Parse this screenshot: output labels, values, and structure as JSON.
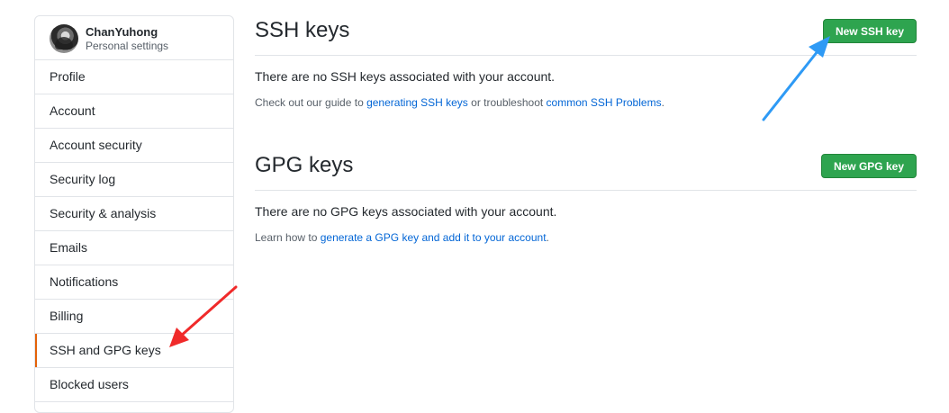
{
  "sidebar": {
    "user": {
      "name": "ChanYuhong",
      "subtitle": "Personal settings"
    },
    "items": [
      {
        "label": "Profile"
      },
      {
        "label": "Account"
      },
      {
        "label": "Account security"
      },
      {
        "label": "Security log"
      },
      {
        "label": "Security & analysis"
      },
      {
        "label": "Emails"
      },
      {
        "label": "Notifications"
      },
      {
        "label": "Billing"
      },
      {
        "label": "SSH and GPG keys",
        "selected": true
      },
      {
        "label": "Blocked users"
      }
    ]
  },
  "ssh": {
    "title": "SSH keys",
    "button": "New SSH key",
    "empty_message": "There are no SSH keys associated with your account.",
    "guide_prefix": "Check out our guide to ",
    "guide_link": "generating SSH keys",
    "guide_middle": " or troubleshoot ",
    "troubleshoot_link": "common SSH Problems",
    "guide_suffix": "."
  },
  "gpg": {
    "title": "GPG keys",
    "button": "New GPG key",
    "empty_message": "There are no GPG keys associated with your account.",
    "learn_prefix": "Learn how to ",
    "learn_link": "generate a GPG key and add it to your account",
    "learn_suffix": "."
  },
  "colors": {
    "primary_button": "#2ea44f",
    "link": "#0366d6",
    "selected_indicator": "#e36209",
    "annotation_blue": "#2e9af5",
    "annotation_red": "#f02a2a"
  }
}
